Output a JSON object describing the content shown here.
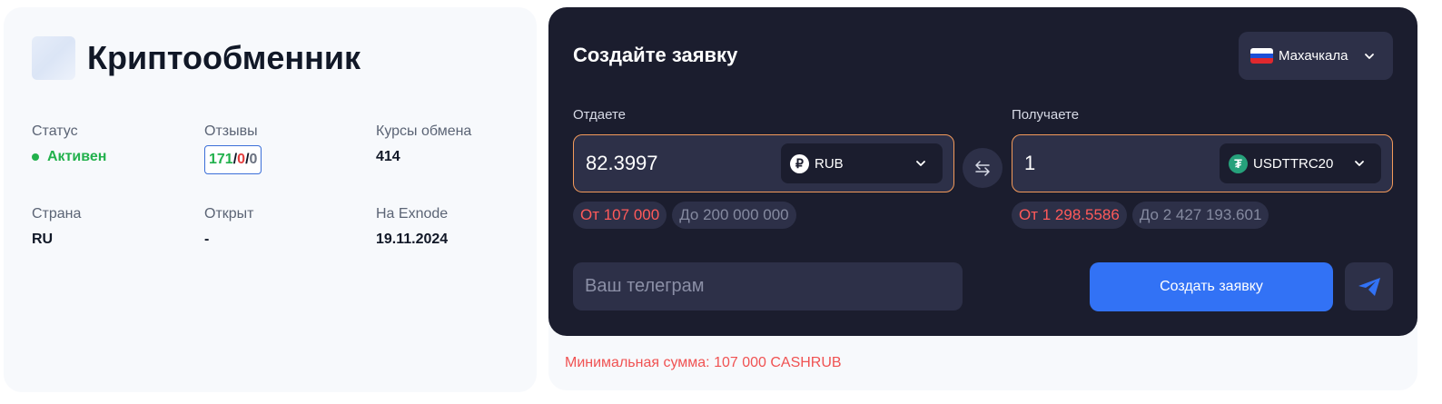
{
  "brand": {
    "title": "Криптообменник"
  },
  "info": {
    "status_label": "Статус",
    "status_value": "Активен",
    "reviews_label": "Отзывы",
    "reviews_positive": "171",
    "reviews_negative": "0",
    "reviews_neutral": "0",
    "reviews_sep": "/",
    "rates_label": "Курсы обмена",
    "rates_value": "414",
    "country_label": "Страна",
    "country_value": "RU",
    "opened_label": "Открыт",
    "opened_value": "-",
    "exnode_label": "На Exnode",
    "exnode_value": "19.11.2024"
  },
  "form": {
    "title": "Создайте заявку",
    "city": "Махачкала",
    "give": {
      "label": "Отдаете",
      "amount": "82.3997",
      "currency": "RUB",
      "currency_icon": "ruble-icon",
      "min": "От 107 000",
      "max": "До 200 000 000"
    },
    "receive": {
      "label": "Получаете",
      "amount": "1",
      "currency": "USDTTRC20",
      "currency_icon": "tether-icon",
      "min": "От 1 298.5586",
      "max": "До 2 427 193.601"
    },
    "telegram_placeholder": "Ваш телеграм",
    "create_button": "Создать заявку",
    "min_sum_note": "Минимальная сумма: 107 000 CASHRUB"
  },
  "colors": {
    "accent": "#3272f5",
    "panel": "#1b1d2e",
    "input_bg": "#2d3048",
    "input_border": "#f39a5b",
    "error": "#ff5a5a",
    "active": "#22b14c",
    "tether": "#26a17b"
  }
}
